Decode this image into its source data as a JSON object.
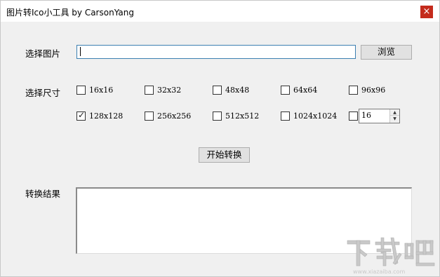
{
  "window": {
    "title": "图片转Ico小工具 by CarsonYang",
    "close_glyph": "×"
  },
  "image": {
    "label": "选择图片",
    "path_value": "",
    "browse_label": "浏览"
  },
  "sizes": {
    "label": "选择尺寸",
    "options": [
      {
        "label": "16x16",
        "checked": false
      },
      {
        "label": "32x32",
        "checked": false
      },
      {
        "label": "48x48",
        "checked": false
      },
      {
        "label": "64x64",
        "checked": false
      },
      {
        "label": "96x96",
        "checked": false
      },
      {
        "label": "128x128",
        "checked": true
      },
      {
        "label": "256x256",
        "checked": false
      },
      {
        "label": "512x512",
        "checked": false
      },
      {
        "label": "1024x1024",
        "checked": false
      }
    ],
    "custom": {
      "checked": false,
      "value": "16"
    }
  },
  "convert": {
    "button_label": "开始转换"
  },
  "result": {
    "label": "转换结果",
    "text": ""
  },
  "watermark": {
    "text": "下载吧",
    "sub_text": "www.xiazaiba.com",
    "color": "#c9c9c9"
  }
}
